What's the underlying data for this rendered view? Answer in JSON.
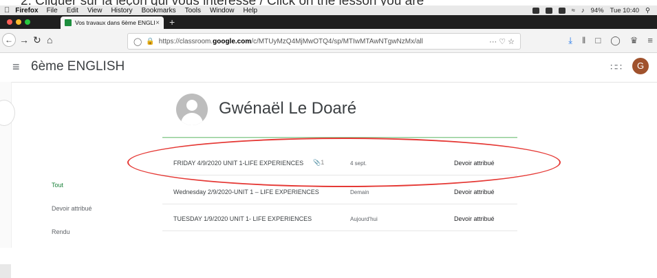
{
  "caption": "2.  Cliquer sur la leçon qui vous intéresse / Click on the lesson you are",
  "menubar": {
    "app": "Firefox",
    "items": [
      "File",
      "Edit",
      "View",
      "History",
      "Bookmarks",
      "Tools",
      "Window",
      "Help"
    ],
    "battery": "94%",
    "clock": "Tue 10:40"
  },
  "tab": {
    "title": "Vos travaux dans 6ème ENGLISH",
    "close": "×",
    "new_tab": "+"
  },
  "navbar": {
    "url_prefix": "https://classroom.",
    "url_domain": "google.com",
    "url_path": "/c/MTUyMzQ4MjMwOTQ4/sp/MTIwMTAwNTgwNzMx/all",
    "url_extras": "··· ♡ ☆"
  },
  "appbar": {
    "class_name": "6ème ENGLISH",
    "avatar_letter": "G"
  },
  "student": {
    "name": "Gwénaël Le Doaré"
  },
  "filters": [
    {
      "label": "Tout",
      "active": true
    },
    {
      "label": "Devoir attribué",
      "active": false
    },
    {
      "label": "Rendu",
      "active": false
    }
  ],
  "assignments": [
    {
      "title": "FRIDAY 4/9/2020 UNIT 1-LIFE EXPERIENCES",
      "attachments": "1",
      "date": "4 sept.",
      "status": "Devoir attribué"
    },
    {
      "title": "Wednesday 2/9/2020-UNIT 1 – LIFE EXPERIENCES",
      "attachments": "",
      "date": "Demain",
      "status": "Devoir attribué"
    },
    {
      "title": "TUESDAY 1/9/2020 UNIT 1- LIFE EXPERIENCES",
      "attachments": "",
      "date": "Aujourd'hui",
      "status": "Devoir attribué"
    }
  ],
  "colors": {
    "accent_green": "#188038",
    "annotation_red": "#e53935"
  }
}
